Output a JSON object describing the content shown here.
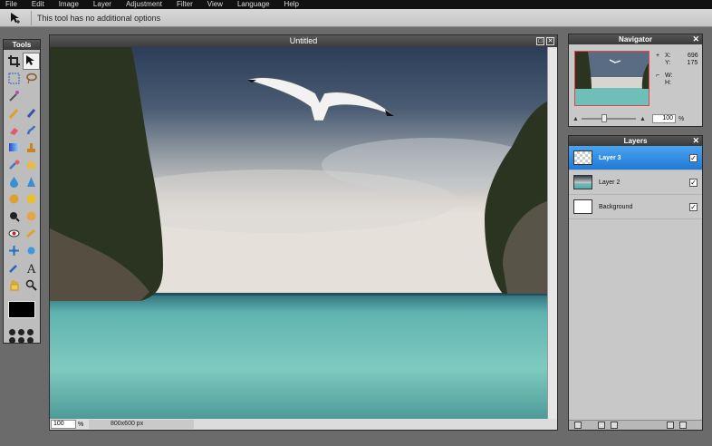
{
  "menu": [
    "File",
    "Edit",
    "Image",
    "Layer",
    "Adjustment",
    "Filter",
    "View",
    "Language",
    "Help"
  ],
  "options_bar": {
    "message": "This tool has no additional options"
  },
  "tools_panel": {
    "title": "Tools",
    "foreground_color": "#000000"
  },
  "document": {
    "title": "Untitled",
    "zoom_value": "100",
    "zoom_unit": "%",
    "size": "800x600 px"
  },
  "navigator": {
    "title": "Navigator",
    "x_label": "X:",
    "x_value": "696",
    "y_label": "Y:",
    "y_value": "175",
    "w_label": "W:",
    "h_label": "H:",
    "zoom_value": "100",
    "zoom_unit": "%"
  },
  "layers": {
    "title": "Layers",
    "items": [
      {
        "name": "Layer 3",
        "selected": true,
        "visible": true
      },
      {
        "name": "Layer 2",
        "selected": false,
        "visible": true
      },
      {
        "name": "Background",
        "selected": false,
        "visible": true
      }
    ]
  },
  "colors": {
    "selection_blue": "#2f8de4",
    "panel_grey": "#c8c8c8",
    "workspace": "#6b6b6b"
  }
}
